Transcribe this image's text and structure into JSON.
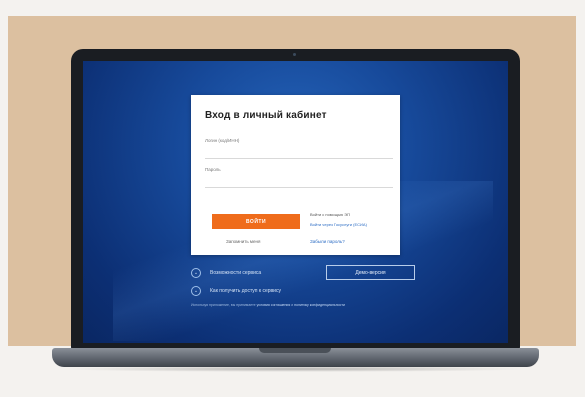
{
  "login": {
    "title": "Вход в личный кабинет",
    "username_label": "Логин (код/ИНН)",
    "password_label": "Пароль",
    "submit_label": "ВОЙТИ",
    "alt_login_1": "Войти с помощью ЭП",
    "alt_login_2": "Войти через Госуслуги (ЕСИА)",
    "remember_label": "Запомнить меня",
    "forgot_label": "Забыли пароль?"
  },
  "features": {
    "item1": "Возможности сервиса",
    "item2": "Как получить доступ к сервису",
    "item1_icon": "chevron-down-icon",
    "item2_icon": "chevron-down-icon"
  },
  "demo": {
    "label": "Демо-версия"
  },
  "footer": {
    "text": "Используя приложение, вы принимаете",
    "link1": "условия соглашения",
    "link2": "политику конфиденциальности"
  },
  "colors": {
    "accent": "#ef6c1b",
    "screen_bg": "#174a9b",
    "link": "#2b6cc4"
  }
}
